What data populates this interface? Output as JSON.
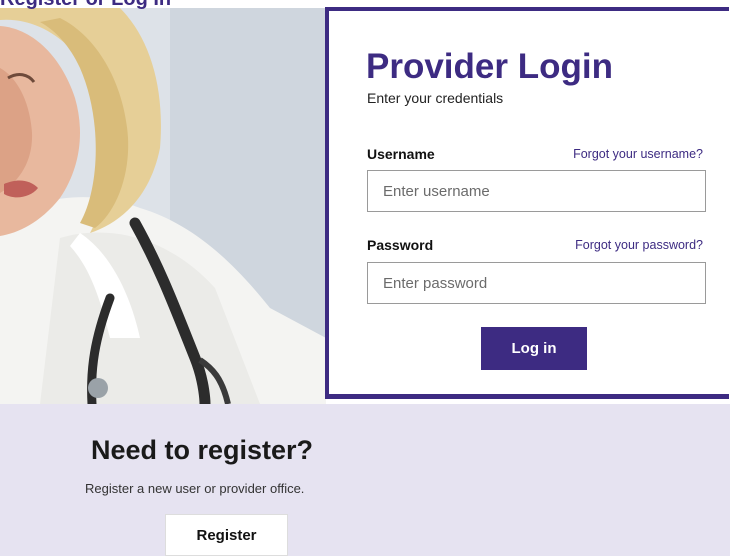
{
  "header": {
    "cut_text": "Register or Log In"
  },
  "login": {
    "title": "Provider Login",
    "subtitle": "Enter your credentials",
    "username_label": "Username",
    "forgot_username": "Forgot your username?",
    "username_placeholder": "Enter username",
    "username_value": "",
    "password_label": "Password",
    "forgot_password": "Forgot your password?",
    "password_placeholder": "Enter password",
    "password_value": "",
    "login_button": "Log in"
  },
  "register": {
    "title": "Need to register?",
    "subtitle": "Register a new user or provider office.",
    "button": "Register"
  },
  "colors": {
    "brand": "#3d2b82",
    "register_bg": "#e6e3f1"
  }
}
